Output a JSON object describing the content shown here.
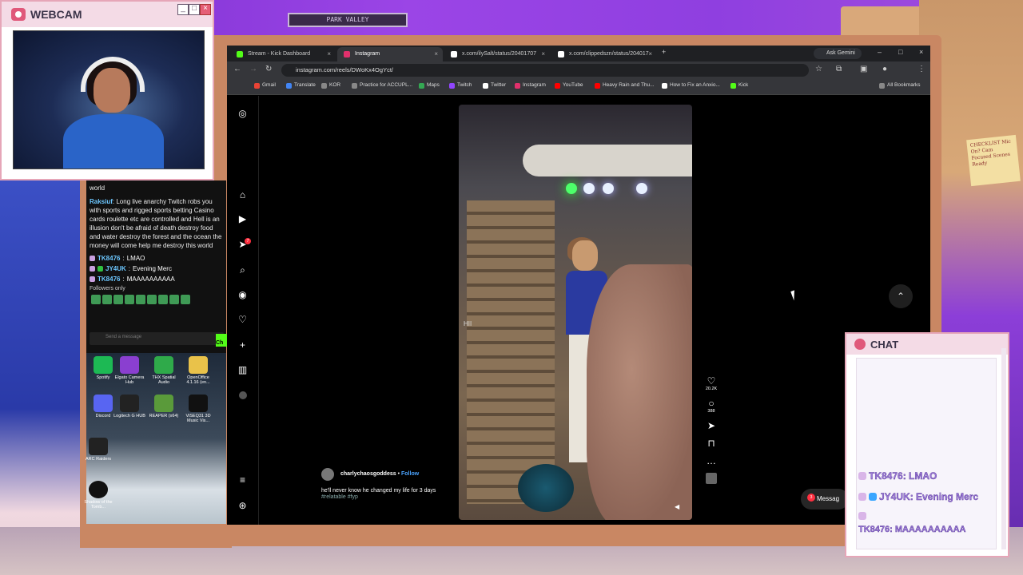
{
  "webcam": {
    "title": "WEBCAM",
    "controls": {
      "minimize": "_",
      "maximize": "□",
      "close": "×"
    }
  },
  "room": {
    "sign_text": "PARK VALLEY",
    "sticky_note": "CHECKLIST Mic On? Cam Focused Scenes Ready"
  },
  "left_chat": {
    "messages": [
      {
        "text": "world"
      },
      {
        "user": "Raksiuf",
        "text": "Long live anarchy Twitch robs you with sports and rigged sports betting Casino cards roulette etc are controlled and Hell is an illusion don't be afraid of death destroy food and water destroy the forest and the ocean the money will come help me destroy this world"
      },
      {
        "user": "TK8476",
        "text": "LMAO"
      },
      {
        "user": "JY4UK",
        "text": "Evening Merc"
      },
      {
        "user": "TK8476",
        "text": "MAAAAAAAAAA"
      }
    ],
    "followers_only": "Followers only",
    "input_placeholder": "Send a message",
    "send_label": "Ch"
  },
  "desktop_icons": [
    {
      "label": "Spotify",
      "color": "#1db954"
    },
    {
      "label": "Elgato Camera Hub",
      "color": "#8a3fd0"
    },
    {
      "label": "THX Spatial Audio",
      "color": "#2faa4a"
    },
    {
      "label": "OpenOffice 4.1.16 (en...",
      "color": "#e9c24a"
    },
    {
      "label": "Discord",
      "color": "#5865f2"
    },
    {
      "label": "Logitech G HUB",
      "color": "#222222"
    },
    {
      "label": "REAPER (x64)",
      "color": "#5a9a3a"
    },
    {
      "label": "ViSEQ31 3D Music Vis...",
      "color": "#111111"
    },
    {
      "label": "ARC Raiders",
      "color": "#222222"
    },
    {
      "label": "Shadow of the Tomb...",
      "color": "#111111"
    }
  ],
  "browser": {
    "tabs": [
      {
        "label": "Stream - Kick Dashboard",
        "color": "#53fc18",
        "active": false
      },
      {
        "label": "Instagram",
        "color": "#e1306c",
        "active": true
      },
      {
        "label": "x.com/ilySalt/status/20401707",
        "color": "#ffffff",
        "active": false
      },
      {
        "label": "x.com/clippedszn/status/204017",
        "color": "#ffffff",
        "active": false
      }
    ],
    "new_tab": "+",
    "ask_gemini": "Ask Gemini",
    "url": "instagram.com/reels/DWoKx4OgYct/",
    "bookmarks": [
      {
        "label": "Gmail",
        "color": "#ea4335"
      },
      {
        "label": "Translate",
        "color": "#4285f4"
      },
      {
        "label": "KOR",
        "color": "#888888"
      },
      {
        "label": "Practice for ACCUPL...",
        "color": "#888888"
      },
      {
        "label": "Maps",
        "color": "#34a853"
      },
      {
        "label": "Twitch",
        "color": "#9146ff"
      },
      {
        "label": "Twitter",
        "color": "#ffffff"
      },
      {
        "label": "Instagram",
        "color": "#e1306c"
      },
      {
        "label": "YouTube",
        "color": "#ff0000"
      },
      {
        "label": "Heavy Rain and Thu...",
        "color": "#ff0000"
      },
      {
        "label": "How to Fix an Anxio...",
        "color": "#ffffff"
      },
      {
        "label": "Kick",
        "color": "#53fc18"
      }
    ],
    "all_bookmarks": "All Bookmarks"
  },
  "instagram": {
    "sidebar_icons": [
      "instagram-logo-icon",
      "home-icon",
      "reels-icon",
      "send-icon",
      "search-icon",
      "explore-icon",
      "heart-icon",
      "create-icon",
      "dashboard-icon",
      "profile-icon",
      "menu-icon",
      "threads-icon"
    ],
    "notification_count": "7",
    "reel": {
      "overlay_text": "HII",
      "username": "charlychaosgoddess",
      "separator": "•",
      "follow": "Follow",
      "caption": "he'll never know he changed my life for 3 days",
      "tags": "#relatable #fyp",
      "likes": "20.2K",
      "comments": "388"
    },
    "messages_label": "Messag",
    "messages_badge": "3"
  },
  "chat_overlay": {
    "title": "CHAT",
    "messages": [
      {
        "user": "TK8476",
        "text": "LMAO",
        "badge": "bunny"
      },
      {
        "user": "JY4UK",
        "text": "Evening Merc",
        "badge": "cube"
      },
      {
        "user": "TK8476",
        "text": "MAAAAAAAAAA",
        "badge": "bunny"
      }
    ]
  }
}
